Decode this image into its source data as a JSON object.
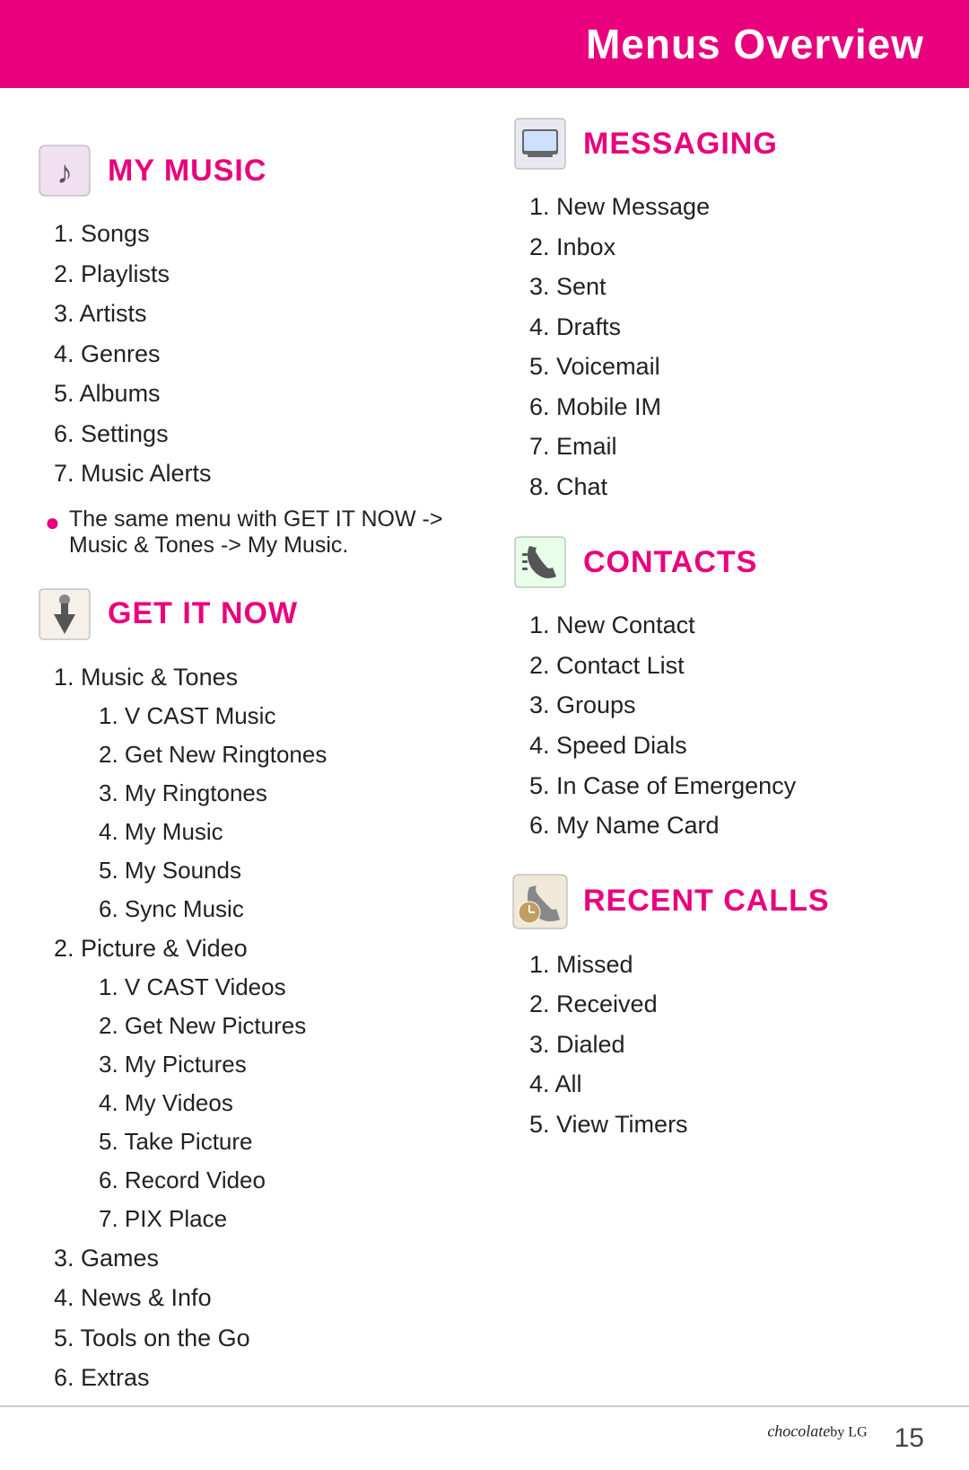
{
  "header": {
    "title": "Menus  Overview"
  },
  "left_column": {
    "my_music": {
      "title": "MY MUSIC",
      "items": [
        "1. Songs",
        "2. Playlists",
        "3. Artists",
        "4. Genres",
        "5. Albums",
        "6. Settings",
        "7. Music Alerts"
      ],
      "note": "The same menu with GET IT NOW -> Music & Tones -> My Music."
    },
    "get_it_now": {
      "title": "GET IT NOW",
      "items": [
        {
          "label": "1. Music & Tones",
          "sub": [
            "1. V CAST Music",
            "2. Get New Ringtones",
            "3. My Ringtones",
            "4. My Music",
            "5. My Sounds",
            "6. Sync Music"
          ]
        },
        {
          "label": "2. Picture & Video",
          "sub": [
            "1. V CAST Videos",
            "2. Get New Pictures",
            "3. My Pictures",
            "4. My Videos",
            "5. Take Picture",
            "6. Record Video",
            "7. PIX Place"
          ]
        },
        {
          "label": "3.  Games",
          "sub": []
        },
        {
          "label": "4.  News & Info",
          "sub": []
        },
        {
          "label": "5.  Tools on the Go",
          "sub": []
        },
        {
          "label": "6.  Extras",
          "sub": []
        }
      ]
    }
  },
  "right_column": {
    "messaging": {
      "title": "MESSAGING",
      "items": [
        "1.  New Message",
        "2.  Inbox",
        "3.  Sent",
        "4.  Drafts",
        "5.  Voicemail",
        "6.  Mobile IM",
        "7.  Email",
        "8.  Chat"
      ]
    },
    "contacts": {
      "title": "CONTACTS",
      "items": [
        "1.  New Contact",
        "2.  Contact List",
        "3.  Groups",
        "4.  Speed Dials",
        "5.  In Case of Emergency",
        "6.  My Name Card"
      ]
    },
    "recent_calls": {
      "title": "RECENT CALLS",
      "items": [
        "1.  Missed",
        "2.  Received",
        "3.  Dialed",
        "4.  All",
        "5.  View Timers"
      ]
    }
  },
  "footer": {
    "brand": "chocolate",
    "brand_suffix": "by LG",
    "page": "15"
  }
}
